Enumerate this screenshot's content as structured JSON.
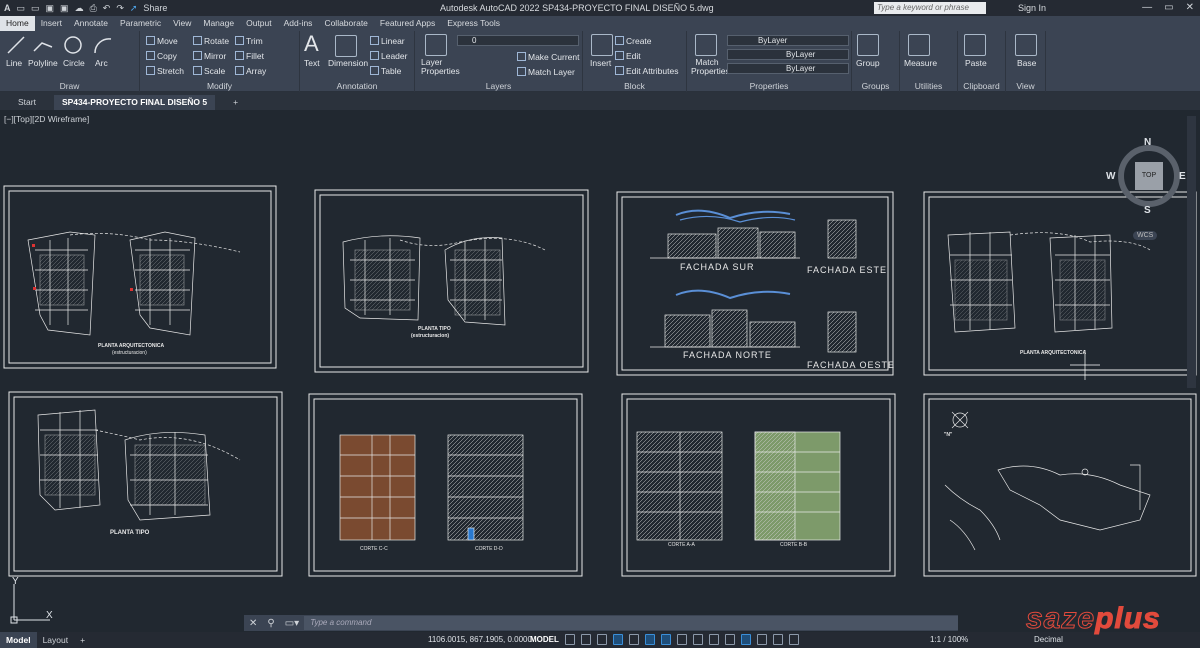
{
  "titlebar": {
    "logo": "A",
    "app_title": "Autodesk AutoCAD 2022   SP434-PROYECTO FINAL DISEÑO 5.dwg",
    "share": "Share",
    "search_placeholder": "Type a keyword or phrase",
    "sign_in": "Sign In"
  },
  "ribbon_tabs": [
    "Home",
    "Insert",
    "Annotate",
    "Parametric",
    "View",
    "Manage",
    "Output",
    "Add-ins",
    "Collaborate",
    "Featured Apps",
    "Express Tools"
  ],
  "draw": {
    "title": "Draw",
    "line": "Line",
    "polyline": "Polyline",
    "circle": "Circle",
    "arc": "Arc"
  },
  "modify": {
    "title": "Modify",
    "move": "Move",
    "rotate": "Rotate",
    "trim": "Trim",
    "copy": "Copy",
    "mirror": "Mirror",
    "fillet": "Fillet",
    "stretch": "Stretch",
    "scale": "Scale",
    "array": "Array"
  },
  "annotation": {
    "title": "Annotation",
    "text": "Text",
    "dimension": "Dimension",
    "linear": "Linear",
    "leader": "Leader",
    "table": "Table"
  },
  "layers": {
    "title": "Layers",
    "layer_properties": "Layer Properties",
    "layer_name": "0",
    "make_current": "Make Current",
    "match_layer": "Match Layer"
  },
  "block": {
    "title": "Block",
    "insert": "Insert",
    "create": "Create",
    "edit": "Edit",
    "edit_attributes": "Edit Attributes"
  },
  "properties": {
    "title": "Properties",
    "match": "Match Properties",
    "color": "ByLayer",
    "linetype": "ByLayer",
    "lineweight": "ByLayer"
  },
  "groups": {
    "title": "Groups",
    "group": "Group"
  },
  "utilities": {
    "title": "Utilities",
    "measure": "Measure"
  },
  "clipboard": {
    "title": "Clipboard",
    "paste": "Paste"
  },
  "view": {
    "title": "View",
    "base": "Base"
  },
  "doc_tabs": [
    "Start",
    "SP434-PROYECTO FINAL DISEÑO 5"
  ],
  "viewport_label": "[−][Top][2D Wireframe]",
  "viewcube": {
    "n": "N",
    "s": "S",
    "e": "E",
    "w": "W",
    "top": "TOP",
    "wcs": "WCS"
  },
  "sheets": {
    "s1": "PLANTA ARQUITECTONICA",
    "s1b": "(estructuracion)",
    "s2": "PLANTA TIPO",
    "s2b": "(estructuracion)",
    "s3a": "FACHADA SUR",
    "s3b": "FACHADA ESTE",
    "s3c": "FACHADA NORTE",
    "s3d": "FACHADA OESTE",
    "s4": "PLANTA ARQUITECTONICA",
    "s5": "PLANTA TIPO",
    "s6a": "CORTE C-C",
    "s6b": "CORTE D-D",
    "s7a": "CORTE A-A",
    "s7b": "CORTE B-B",
    "s8": "\"N\""
  },
  "ucs": {
    "x": "X",
    "y": "Y"
  },
  "command": {
    "placeholder": "Type a command"
  },
  "status": {
    "tabs": [
      "Model",
      "Layout"
    ],
    "coords": "1106.0015, 867.1905, 0.0000",
    "model": "MODEL",
    "scale": "1:1 / 100%",
    "units": "Decimal"
  },
  "watermark": "saze",
  "watermark2": "plus"
}
